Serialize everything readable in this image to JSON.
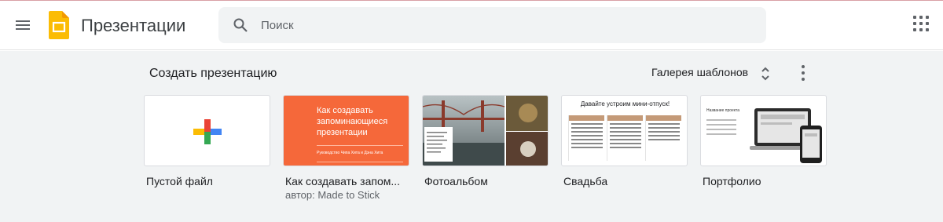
{
  "header": {
    "app_title": "Презентации",
    "search_placeholder": "Поиск",
    "icons": [
      "menu-icon",
      "slides-logo-icon",
      "search-icon",
      "apps-grid-icon"
    ]
  },
  "gallery": {
    "section_title": "Создать презентацию",
    "template_gallery_label": "Галерея шаблонов",
    "templates": [
      {
        "label": "Пустой файл",
        "subtitle": ""
      },
      {
        "label": "Как создавать запом...",
        "subtitle": "автор: Made to Stick",
        "thumb_title": "Как создавать запоминающиеся презентации",
        "thumb_subtitle": "Руководство Чипа Хита и Дэна Хита"
      },
      {
        "label": "Фотоальбом",
        "subtitle": ""
      },
      {
        "label": "Свадьба",
        "subtitle": "",
        "thumb_title": "Давайте устроим мини-отпуск!"
      },
      {
        "label": "Портфолио",
        "subtitle": "",
        "thumb_title": "Название проекта"
      }
    ]
  },
  "colors": {
    "gallery_bg": "#f1f3f4",
    "accent_orange": "#f5683a",
    "logo_yellow": "#fbbc04"
  }
}
